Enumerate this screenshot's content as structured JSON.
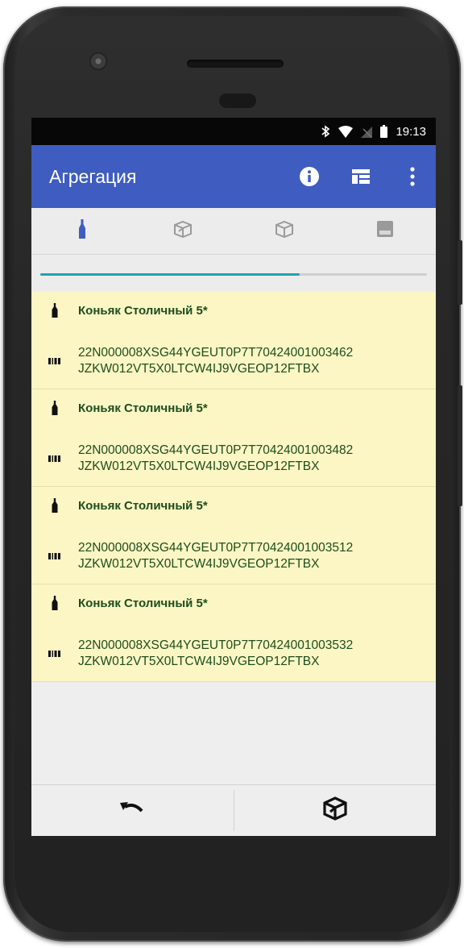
{
  "status_bar": {
    "time": "19:13",
    "icons": [
      "bluetooth-icon",
      "wifi-icon",
      "no-sim-icon",
      "battery-icon"
    ]
  },
  "app_bar": {
    "title": "Агрегация",
    "actions": [
      "info-icon",
      "layout-icon",
      "more-vert-icon"
    ]
  },
  "tabs": [
    {
      "icon": "bottle-icon",
      "selected": true
    },
    {
      "icon": "open-box-icon",
      "selected": false
    },
    {
      "icon": "box-icon",
      "selected": false
    },
    {
      "icon": "pallet-icon",
      "selected": false
    }
  ],
  "progress": {
    "fraction": 0.67,
    "color": "#1fa3b0"
  },
  "items": [
    {
      "name": "Коньяк Столичный 5*",
      "code_line1": "22N000008XSG44YGEUT0P7T70424001003462",
      "code_line2": "JZKW012VT5X0LTCW4IJ9VGEOP12FTBX"
    },
    {
      "name": "Коньяк Столичный 5*",
      "code_line1": "22N000008XSG44YGEUT0P7T70424001003482",
      "code_line2": "JZKW012VT5X0LTCW4IJ9VGEOP12FTBX"
    },
    {
      "name": "Коньяк Столичный 5*",
      "code_line1": "22N000008XSG44YGEUT0P7T70424001003512",
      "code_line2": "JZKW012VT5X0LTCW4IJ9VGEOP12FTBX"
    },
    {
      "name": "Коньяк Столичный 5*",
      "code_line1": "22N000008XSG44YGEUT0P7T70424001003532",
      "code_line2": "JZKW012VT5X0LTCW4IJ9VGEOP12FTBX"
    }
  ],
  "bottom_bar": {
    "buttons": [
      "undo-icon",
      "box-pack-icon"
    ]
  },
  "colors": {
    "app_bar": "#3f5cc1",
    "item_bg": "#fbf6c4",
    "item_text": "#1e4d1e",
    "accent": "#1fa3b0"
  }
}
